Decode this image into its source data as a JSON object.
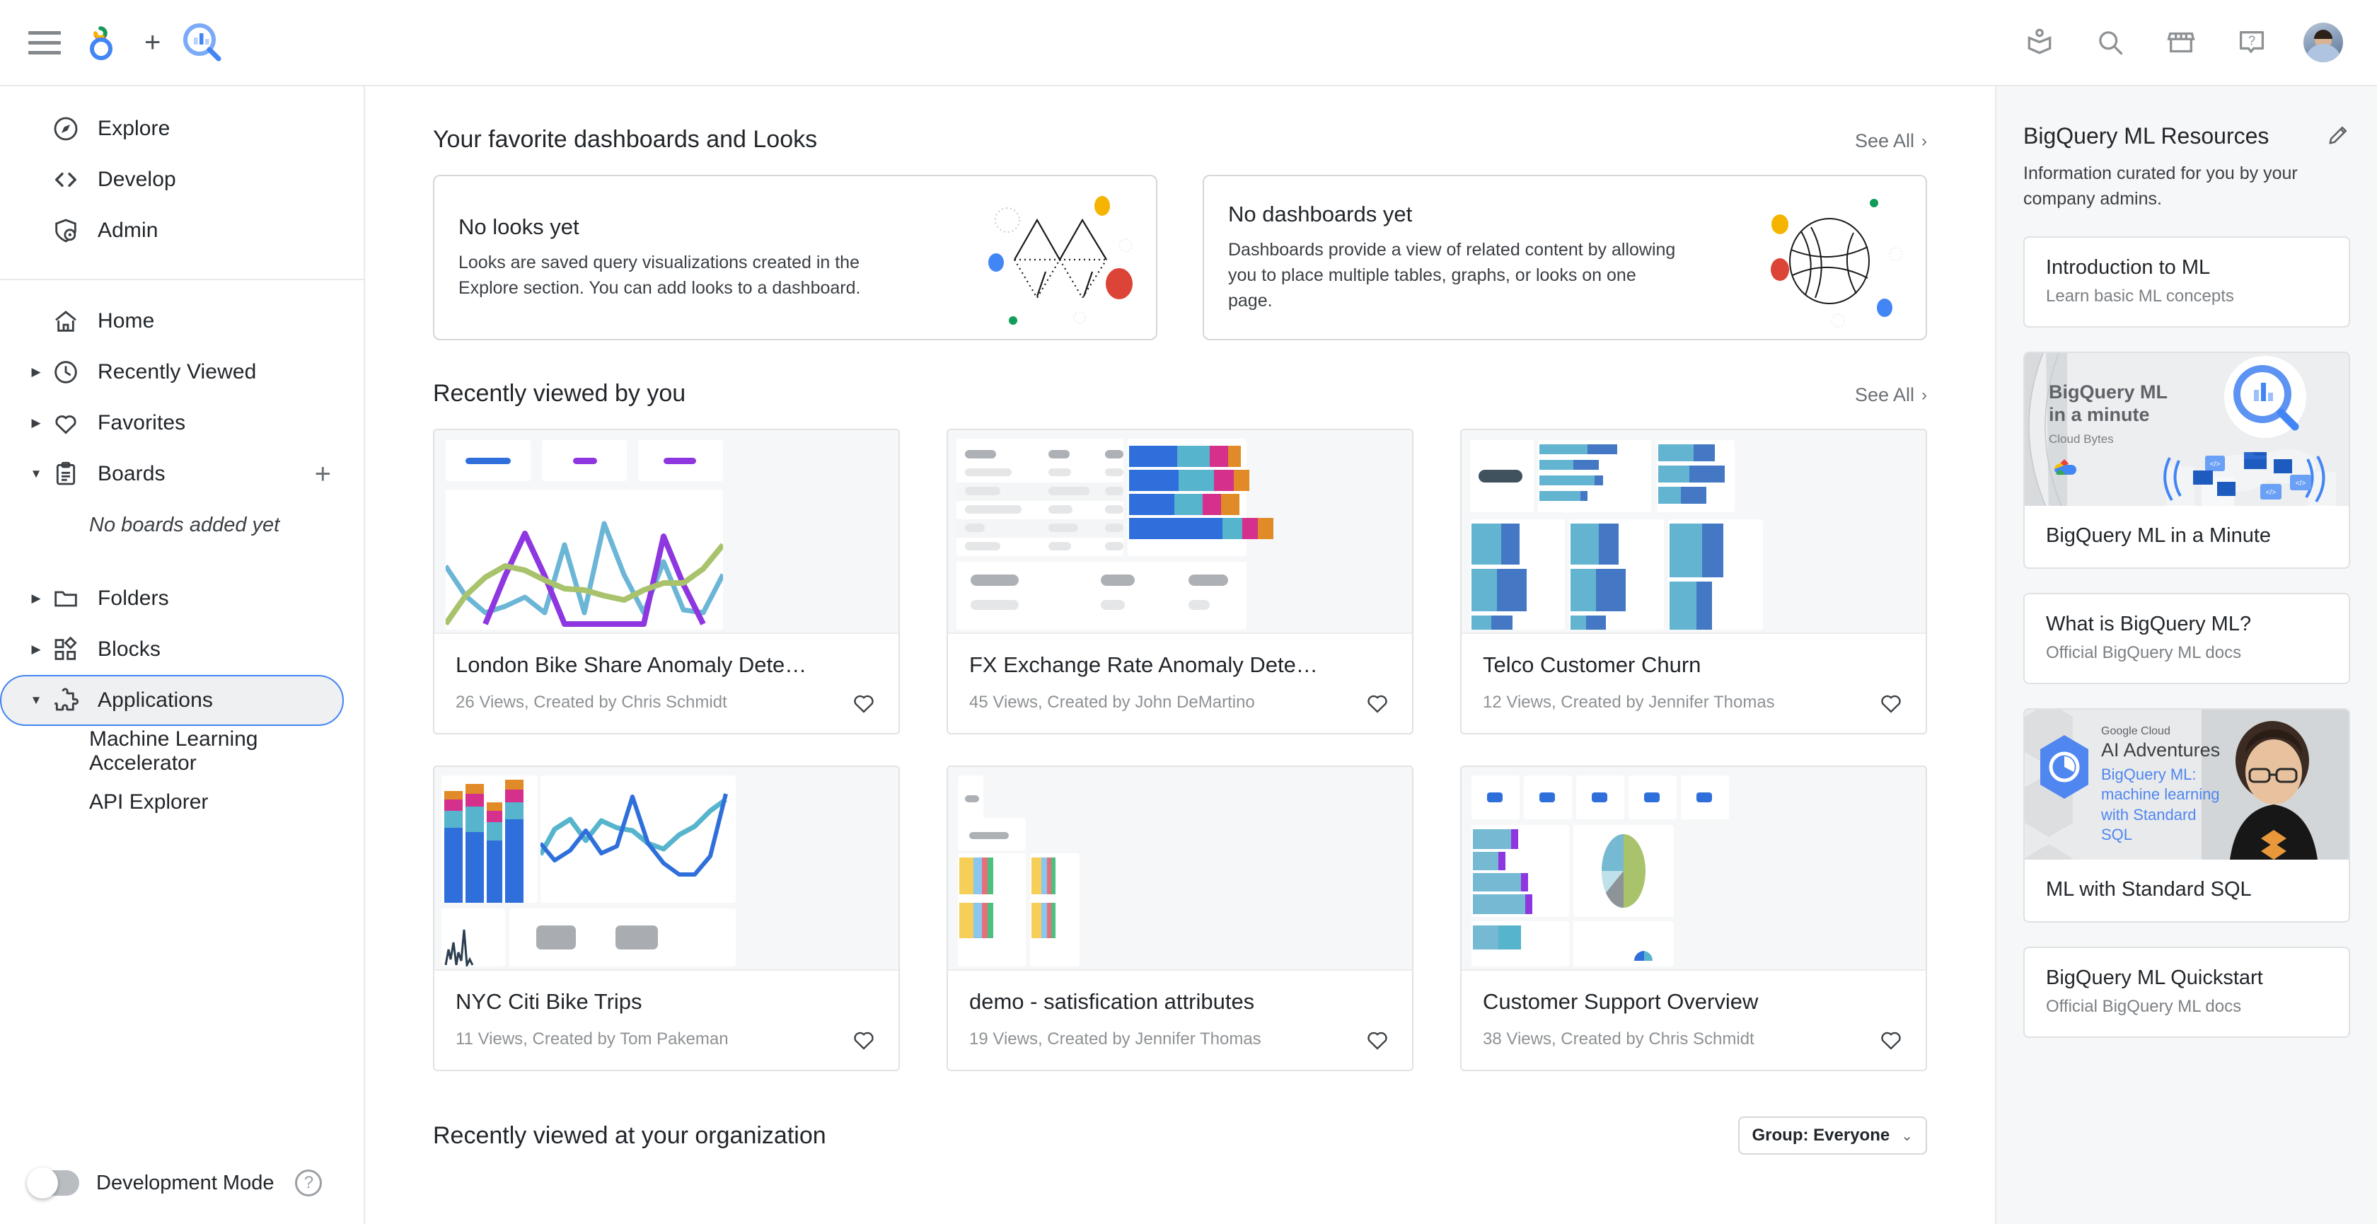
{
  "header": {
    "menu_label": "Main menu",
    "logo_alt": "Looker",
    "plus": "+",
    "product_logo_alt": "BigQuery",
    "icons": [
      {
        "name": "learn-icon",
        "label": "Learn"
      },
      {
        "name": "search-icon",
        "label": "Search"
      },
      {
        "name": "marketplace-icon",
        "label": "Marketplace"
      },
      {
        "name": "help-icon",
        "label": "Help"
      }
    ],
    "avatar_label": "User account"
  },
  "sidebar": {
    "top_items": [
      {
        "label": "Explore",
        "icon": "compass-icon"
      },
      {
        "label": "Develop",
        "icon": "code-icon"
      },
      {
        "label": "Admin",
        "icon": "shield-icon"
      }
    ],
    "nav_items": [
      {
        "label": "Home",
        "icon": "home-icon",
        "caret": "",
        "selected": false
      },
      {
        "label": "Recently Viewed",
        "icon": "clock-icon",
        "caret": "▶",
        "selected": false
      },
      {
        "label": "Favorites",
        "icon": "heart-icon",
        "caret": "▶",
        "selected": false
      },
      {
        "label": "Boards",
        "icon": "clipboard-icon",
        "caret": "▼",
        "selected": false
      }
    ],
    "boards_add_label": "+",
    "boards_empty": "No boards added yet",
    "lower_items": [
      {
        "label": "Folders",
        "icon": "folder-icon",
        "caret": "▶",
        "selected": false
      },
      {
        "label": "Blocks",
        "icon": "blocks-icon",
        "caret": "▶",
        "selected": false
      },
      {
        "label": "Applications",
        "icon": "puzzle-icon",
        "caret": "▼",
        "selected": true
      }
    ],
    "app_children": [
      "Machine Learning Accelerator",
      "API Explorer"
    ],
    "dev_mode_label": "Development Mode",
    "dev_mode_on": false,
    "help_glyph": "?"
  },
  "main": {
    "favorites_section": {
      "title": "Your favorite dashboards and Looks",
      "see_all": "See All",
      "chevron": "›",
      "cards": [
        {
          "title": "No looks yet",
          "desc": "Looks are saved query visualizations created in the Explore section. You can add looks to a dashboard.",
          "art": "zigzag-art"
        },
        {
          "title": "No dashboards yet",
          "desc": "Dashboards provide a view of related content by allowing you to place multiple tables, graphs, or looks on one page.",
          "art": "globe-art"
        }
      ]
    },
    "recent_section": {
      "title": "Recently viewed by you",
      "see_all": "See All",
      "chevron": "›",
      "cards": [
        {
          "title": "London Bike Share Anomaly Dete…",
          "meta": "26 Views, Created by Chris Schmidt",
          "thumb": "line-chart"
        },
        {
          "title": "FX Exchange Rate Anomaly Dete…",
          "meta": "45 Views, Created by John DeMartino",
          "thumb": "table-bars"
        },
        {
          "title": "Telco Customer Churn",
          "meta": "12 Views, Created by Jennifer Thomas",
          "thumb": "blue-bars"
        },
        {
          "title": "NYC Citi Bike Trips",
          "meta": "11 Views, Created by Tom Pakeman",
          "thumb": "stacked-line"
        },
        {
          "title": "demo - satisfication attributes",
          "meta": "19 Views, Created by Jennifer Thomas",
          "thumb": "yellow-bars"
        },
        {
          "title": "Customer Support Overview",
          "meta": "38 Views, Created by Chris Schmidt",
          "thumb": "pie-bars"
        }
      ]
    },
    "org_section": {
      "title": "Recently viewed at your organization",
      "group_label": "Group: Everyone",
      "group_caret": "⌄"
    }
  },
  "right_panel": {
    "title": "BigQuery ML Resources",
    "edit_icon": "pencil-icon",
    "description": "Information curated for you by your company admins.",
    "cards": [
      {
        "title": "Introduction to ML",
        "sub": "Learn basic ML concepts",
        "thumb": null
      },
      {
        "title": "BigQuery ML in a Minute",
        "sub": null,
        "thumb": "bqml-minute",
        "thumb_heading": "BigQuery ML",
        "thumb_heading2": "in a minute",
        "thumb_sub": "Cloud Bytes"
      },
      {
        "title": "What is BigQuery ML?",
        "sub": "Official BigQuery ML docs",
        "thumb": null
      },
      {
        "title": "ML with Standard SQL",
        "sub": null,
        "thumb": "ai-adventures",
        "thumb_brand": "Google Cloud",
        "thumb_heading": "AI Adventures",
        "thumb_sub": "BigQuery ML: machine learning with Standard SQL"
      },
      {
        "title": "BigQuery ML Quickstart",
        "sub": "Official BigQuery ML docs",
        "thumb": null
      }
    ]
  },
  "colors": {
    "accent": "#4285f4",
    "google_red": "#db4437",
    "google_yellow": "#f4b400",
    "google_green": "#0f9d58",
    "text": "#22262a",
    "muted": "#8e9295",
    "panel_bg": "#f6f7f8"
  }
}
